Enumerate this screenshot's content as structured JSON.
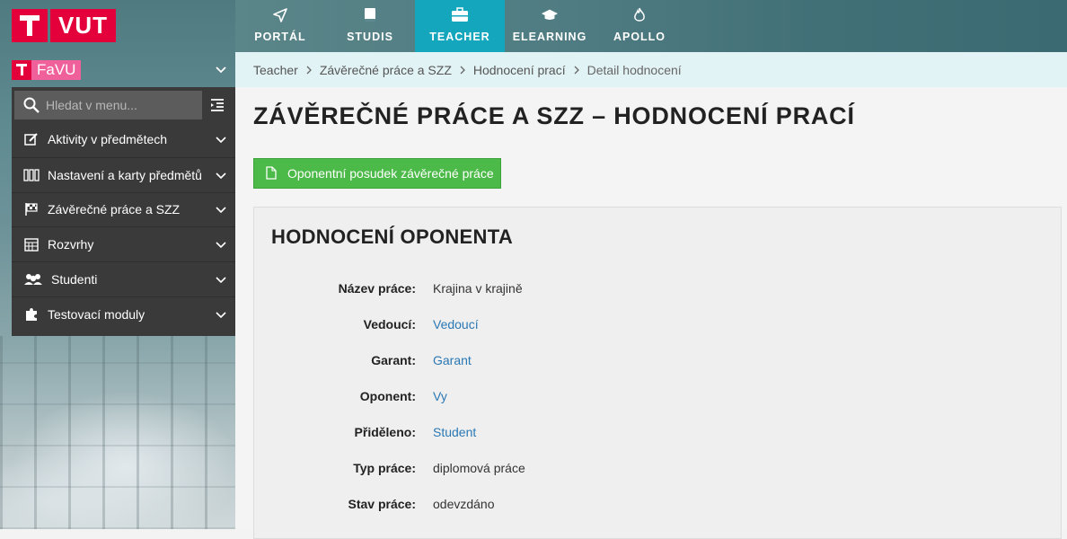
{
  "logo": {
    "text": "VUT"
  },
  "topnav": [
    {
      "label": "PORTÁL",
      "icon": "send-icon",
      "active": false
    },
    {
      "label": "STUDIS",
      "icon": "book-icon",
      "active": false
    },
    {
      "label": "TEACHER",
      "icon": "briefcase-icon",
      "active": true
    },
    {
      "label": "ELEARNING",
      "icon": "graduation-cap-icon",
      "active": false
    },
    {
      "label": "APOLLO",
      "icon": "flame-icon",
      "active": false
    }
  ],
  "faculty": {
    "name": "FaVU"
  },
  "search": {
    "placeholder": "Hledat v menu..."
  },
  "menu": [
    {
      "label": "Aktivity v předmětech",
      "icon": "edit-icon"
    },
    {
      "label": "Nastavení a karty předmětů",
      "icon": "binders-icon"
    },
    {
      "label": "Závěrečné práce a SZZ",
      "icon": "flag-checkered-icon"
    },
    {
      "label": "Rozvrhy",
      "icon": "calendar-icon"
    },
    {
      "label": "Studenti",
      "icon": "users-icon"
    },
    {
      "label": "Testovací moduly",
      "icon": "puzzle-icon"
    }
  ],
  "breadcrumb": [
    "Teacher",
    "Závěrečné práce a SZZ",
    "Hodnocení prací",
    "Detail hodnocení"
  ],
  "page_title": "ZÁVĚREČNÉ PRÁCE A SZZ – HODNOCENÍ PRACÍ",
  "action_button": {
    "label": "Oponentní posudek závěrečné práce",
    "icon": "file-icon"
  },
  "panel": {
    "title": "HODNOCENÍ OPONENTA",
    "rows": [
      {
        "label": "Název práce:",
        "value": "Krajina v krajině",
        "link": false
      },
      {
        "label": "Vedoucí:",
        "value": "Vedoucí",
        "link": true
      },
      {
        "label": "Garant:",
        "value": "Garant",
        "link": true
      },
      {
        "label": "Oponent:",
        "value": "Vy",
        "link": true
      },
      {
        "label": "Přiděleno:",
        "value": "Student",
        "link": true
      },
      {
        "label": "Typ práce:",
        "value": "diplomová práce",
        "link": false
      },
      {
        "label": "Stav práce:",
        "value": "odevzdáno",
        "link": false
      }
    ]
  },
  "colors": {
    "brand_red": "#e4003a",
    "faculty_pink": "#f0609b",
    "nav_active": "#14a6bd",
    "action_green": "#4cba48",
    "link_blue": "#2a78b4",
    "sidebar_bg": "#3a3a3a"
  }
}
